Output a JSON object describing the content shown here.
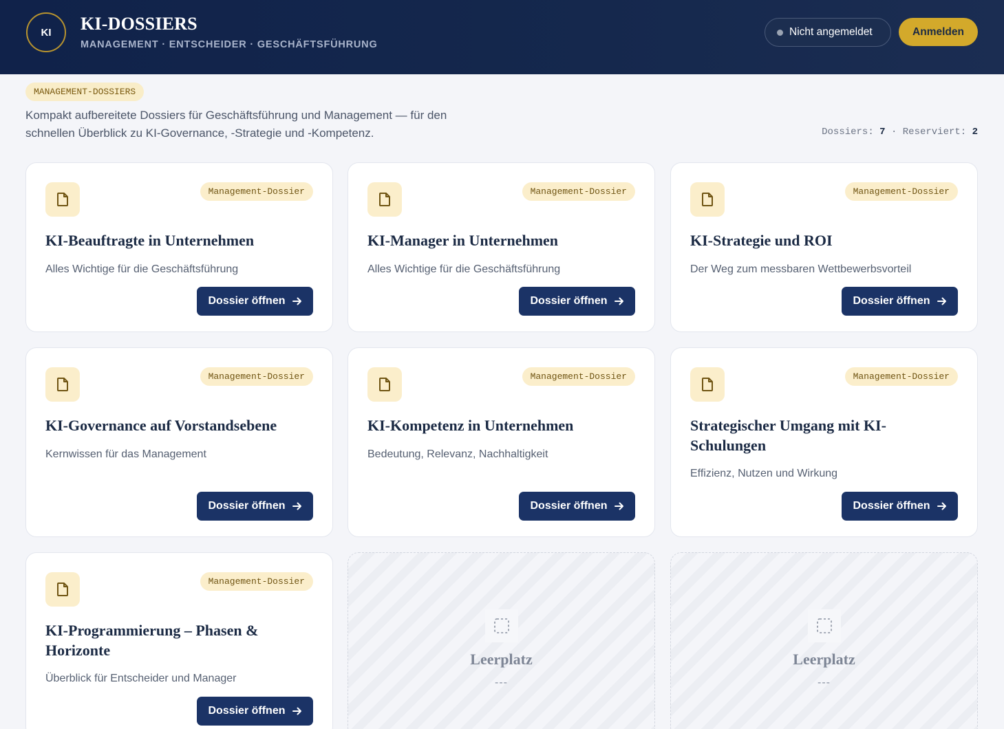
{
  "header": {
    "logo_text": "KI",
    "title": "KI-DOSSIERS",
    "subtitle": "MANAGEMENT · ENTSCHEIDER · GESCHÄFTSFÜHRUNG",
    "status": "Nicht angemeldet",
    "login_label": "Anmelden"
  },
  "intro": {
    "tag": "MANAGEMENT-DOSSIERS",
    "text": "Kompakt aufbereitete Dossiers für Geschäftsführung und Management — für den schnellen Überblick zu KI-Governance, -Strategie und -Kompetenz.",
    "dossiers_label": "Dossiers:",
    "dossiers_count": "7",
    "separator": "·",
    "reserved_label": "Reserviert:",
    "reserved_count": "2"
  },
  "cards": [
    {
      "badge": "Management-Dossier",
      "title": "KI-Beauftragte in Unternehmen",
      "subtitle": "Alles Wichtige für die Geschäftsführung",
      "button": "Dossier öffnen",
      "icon": "document-icon"
    },
    {
      "badge": "Management-Dossier",
      "title": "KI-Manager in Unternehmen",
      "subtitle": "Alles Wichtige für die Geschäftsführung",
      "button": "Dossier öffnen",
      "icon": "document-icon"
    },
    {
      "badge": "Management-Dossier",
      "title": "KI-Strategie und ROI",
      "subtitle": "Der Weg zum messbaren Wettbewerbsvorteil",
      "button": "Dossier öffnen",
      "icon": "document-icon"
    },
    {
      "badge": "Management-Dossier",
      "title": "KI-Governance auf Vorstandsebene",
      "subtitle": "Kernwissen für das Management",
      "button": "Dossier öffnen",
      "icon": "document-icon"
    },
    {
      "badge": "Management-Dossier",
      "title": "KI-Kompetenz in Unternehmen",
      "subtitle": "Bedeutung, Relevanz, Nachhaltigkeit",
      "button": "Dossier öffnen",
      "icon": "document-icon"
    },
    {
      "badge": "Management-Dossier",
      "title": "Strategischer Umgang mit KI-Schulungen",
      "subtitle": "Effizienz, Nutzen und Wirkung",
      "button": "Dossier öffnen",
      "icon": "document-icon"
    },
    {
      "badge": "Management-Dossier",
      "title": "KI-Programmierung – Phasen & Horizonte",
      "subtitle": "Überblick für Entscheider und Manager",
      "button": "Dossier öffnen",
      "icon": "document-icon"
    }
  ],
  "placeholders": [
    {
      "title": "Leerplatz",
      "text": "---",
      "icon": "empty-slot-icon"
    },
    {
      "title": "Leerplatz",
      "text": "---",
      "icon": "empty-slot-icon"
    }
  ],
  "colors": {
    "header_bg": "#10224a",
    "accent_gold": "#d3a92b",
    "button_navy": "#1b3366",
    "badge_bg": "#fbeecb"
  }
}
